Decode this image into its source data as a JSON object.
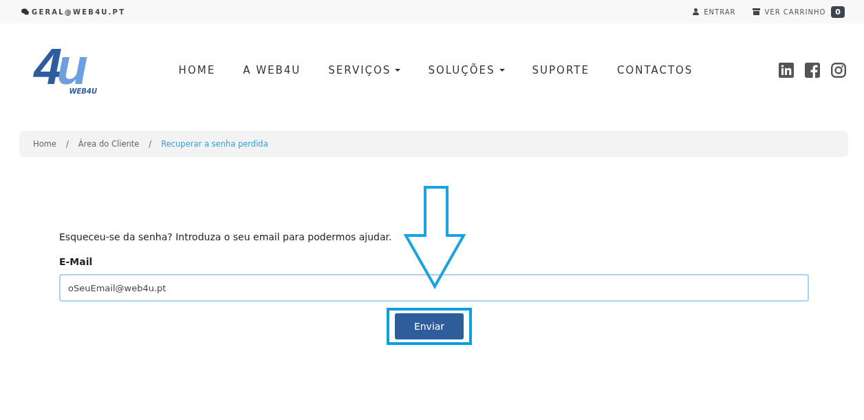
{
  "topbar": {
    "email": "GERAL@WEB4U.PT",
    "login": "ENTRAR",
    "cart": "VER CARRINHO",
    "cart_count": "0"
  },
  "logo": {
    "mark": [
      "4",
      "u"
    ],
    "text": "WEB4U"
  },
  "nav": [
    {
      "label": "HOME",
      "dropdown": false
    },
    {
      "label": "A WEB4U",
      "dropdown": false
    },
    {
      "label": "SERVIÇOS",
      "dropdown": true
    },
    {
      "label": "SOLUÇÕES",
      "dropdown": true
    },
    {
      "label": "SUPORTE",
      "dropdown": false
    },
    {
      "label": "CONTACTOS",
      "dropdown": false
    }
  ],
  "social": [
    {
      "kind": "linkedin"
    },
    {
      "kind": "facebook"
    },
    {
      "kind": "instagram"
    }
  ],
  "breadcrumb": {
    "separator": "/",
    "items": [
      {
        "label": "Home",
        "selected": false
      },
      {
        "label": "Área do Cliente",
        "selected": false
      },
      {
        "label": "Recuperar a senha perdida",
        "selected": true
      }
    ]
  },
  "form": {
    "intro": "Esqueceu-se da senha? Introduza o seu email para podermos ajudar.",
    "label": "E-Mail",
    "value": "oSeuEmail@web4u.pt",
    "submit": "Enviar"
  }
}
